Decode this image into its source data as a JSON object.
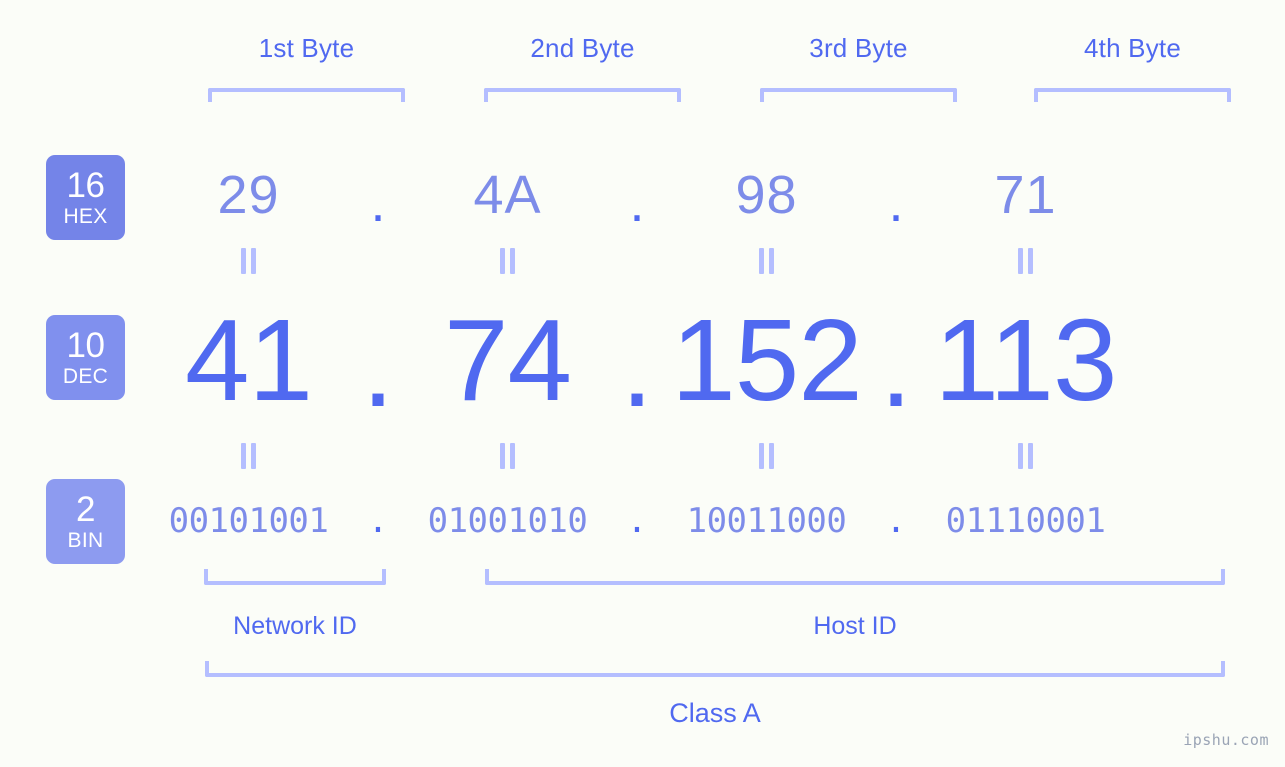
{
  "page": {
    "background_color": "#fbfdf8",
    "accent_strong": "#5069f0",
    "accent_soft": "#7d8ce9",
    "accent_pale": "#b4beff",
    "badge_color": "#7484e8",
    "badge_color_light": "#8d9bf0",
    "watermark": "ipshu.com"
  },
  "byte_headers": [
    {
      "label": "1st Byte"
    },
    {
      "label": "2nd Byte"
    },
    {
      "label": "3rd Byte"
    },
    {
      "label": "4th Byte"
    }
  ],
  "bases": [
    {
      "number": "16",
      "name": "HEX"
    },
    {
      "number": "10",
      "name": "DEC"
    },
    {
      "number": "2",
      "name": "BIN"
    }
  ],
  "separator": ".",
  "equals_symbol": "||",
  "rows": {
    "hex": {
      "base_number": "16",
      "base_name": "HEX",
      "values": [
        "29",
        "4A",
        "98",
        "71"
      ]
    },
    "dec": {
      "base_number": "10",
      "base_name": "DEC",
      "values": [
        "41",
        "74",
        "152",
        "113"
      ]
    },
    "bin": {
      "base_number": "2",
      "base_name": "BIN",
      "values": [
        "00101001",
        "01001010",
        "10011000",
        "01110001"
      ]
    }
  },
  "ip_address": {
    "hex": "29.4A.98.71",
    "decimal": "41.74.152.113",
    "binary": "00101001.01001010.10011000.01110001"
  },
  "segments": {
    "network_id_label": "Network ID",
    "host_id_label": "Host ID",
    "class_label": "Class A"
  }
}
